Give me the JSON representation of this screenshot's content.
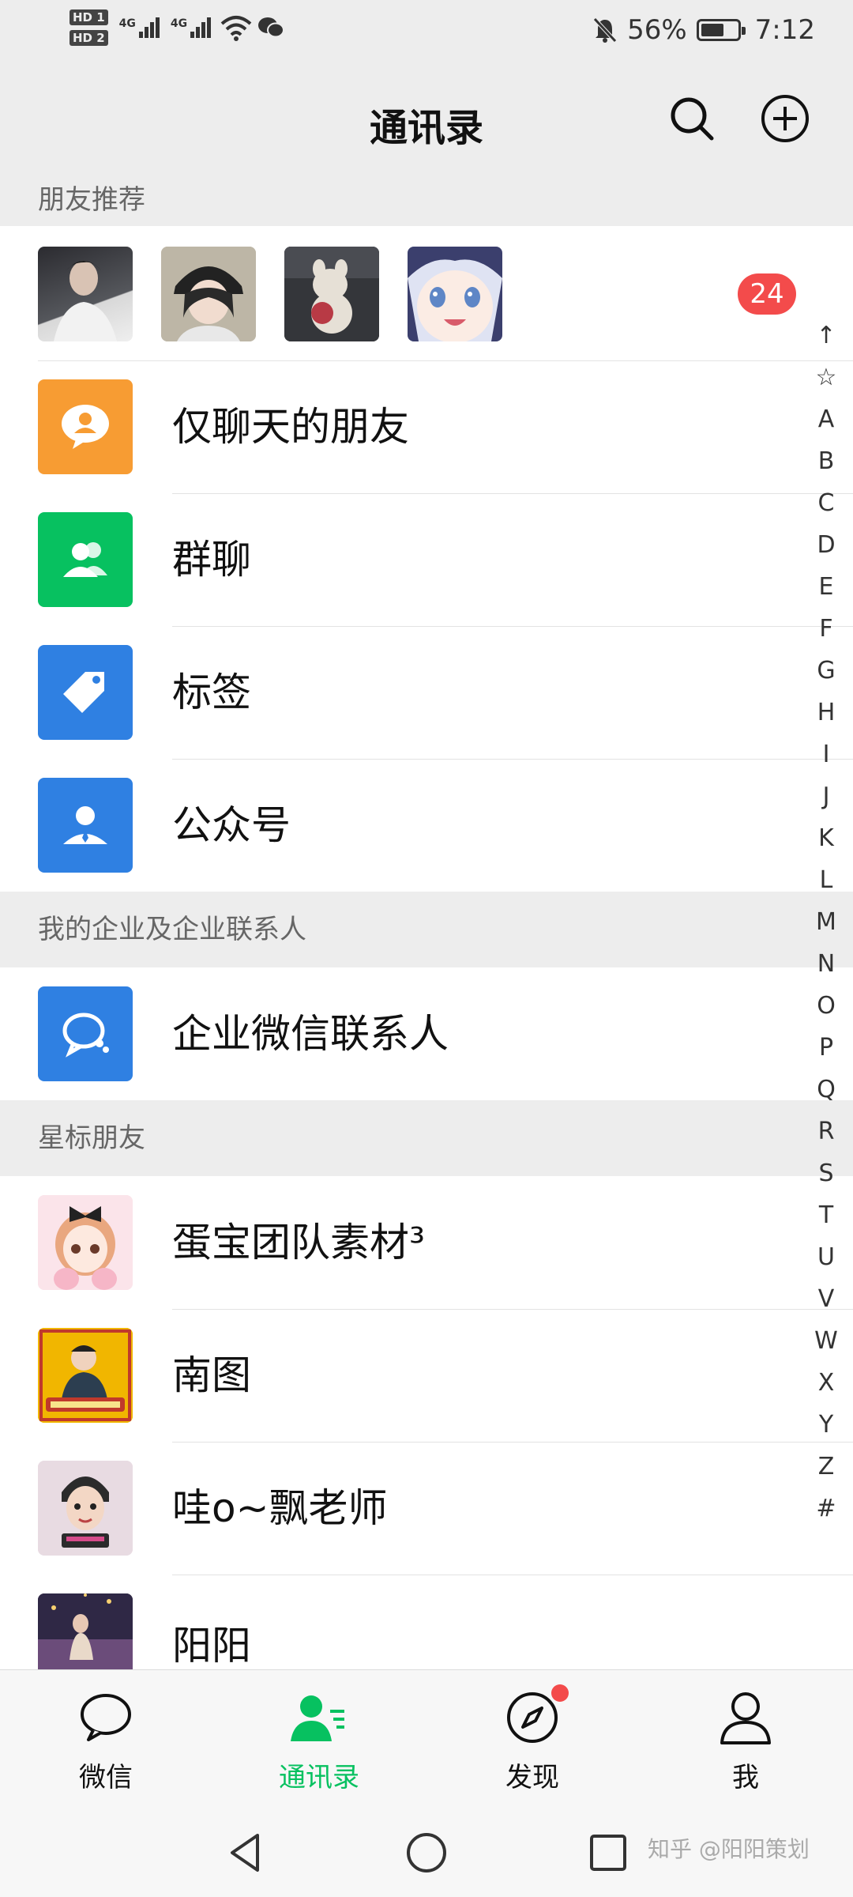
{
  "status_bar": {
    "sim1": "HD 1",
    "sim2": "HD 2",
    "network1": "4G",
    "network2": "4G",
    "battery": "56%",
    "time": "7:12",
    "icons": [
      "signal-icon",
      "wifi-icon",
      "wechat-notify-icon",
      "mute-bell-icon",
      "battery-icon"
    ]
  },
  "header": {
    "title": "通讯录",
    "search_icon": "search-icon",
    "add_icon": "add-circle-icon"
  },
  "recommend": {
    "section_title": "朋友推荐",
    "badge": "24"
  },
  "menu": [
    {
      "label": "仅聊天的朋友",
      "icon": "chat-only-friend-icon",
      "color": "#f79c33"
    },
    {
      "label": "群聊",
      "icon": "group-chat-icon",
      "color": "#07c160"
    },
    {
      "label": "标签",
      "icon": "tag-icon",
      "color": "#2f80e2"
    },
    {
      "label": "公众号",
      "icon": "official-account-icon",
      "color": "#2f80e2"
    }
  ],
  "enterprise": {
    "section_title": "我的企业及企业联系人",
    "label": "企业微信联系人",
    "icon": "wecom-icon",
    "color": "#2f80e2"
  },
  "starred": {
    "section_title": "星标朋友",
    "items": [
      {
        "label": "蛋宝团队素材³"
      },
      {
        "label": "南图"
      },
      {
        "label": "哇o~飘老师"
      },
      {
        "label": "阳阳"
      }
    ]
  },
  "index_bar": [
    "↑",
    "☆",
    "A",
    "B",
    "C",
    "D",
    "E",
    "F",
    "G",
    "H",
    "I",
    "J",
    "K",
    "L",
    "M",
    "N",
    "O",
    "P",
    "Q",
    "R",
    "S",
    "T",
    "U",
    "V",
    "W",
    "X",
    "Y",
    "Z",
    "#"
  ],
  "tabs": [
    {
      "label": "微信",
      "icon": "chat-bubble-icon",
      "active": false
    },
    {
      "label": "通讯录",
      "icon": "contacts-icon",
      "active": true
    },
    {
      "label": "发现",
      "icon": "compass-icon",
      "active": false
    },
    {
      "label": "我",
      "icon": "profile-icon",
      "active": false
    }
  ],
  "watermark": "知乎 @阳阳策划",
  "colors": {
    "accent": "#07c160",
    "badge": "#f34b4b",
    "background": "#ededed"
  }
}
